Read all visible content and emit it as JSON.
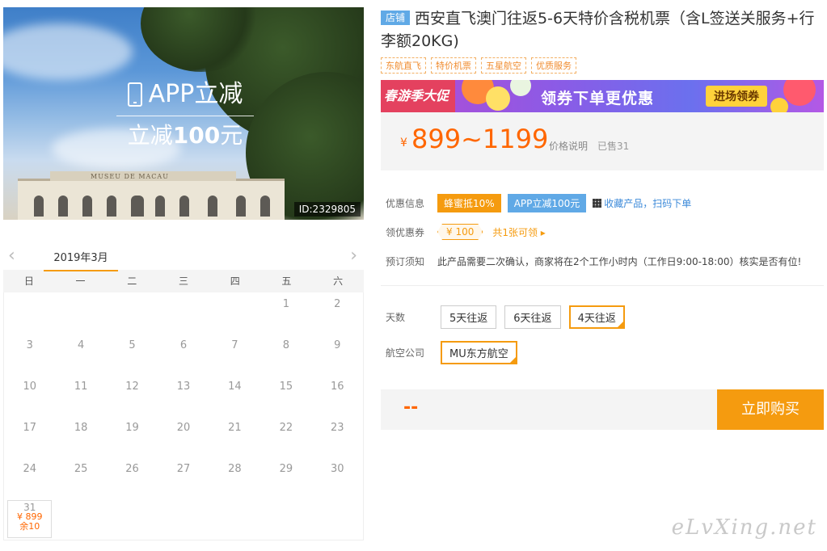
{
  "hero": {
    "app_label": "APP立减",
    "reduce_prefix": "立减",
    "reduce_amount": "100",
    "reduce_suffix": "元",
    "building_sign": "MUSEU DE MACAU",
    "id_tag": "ID:2329805"
  },
  "calendar": {
    "prev_icon": "chevron-left-icon",
    "next_icon": "chevron-right-icon",
    "month": "2019年3月",
    "weekdays": [
      "日",
      "一",
      "二",
      "三",
      "四",
      "五",
      "六"
    ],
    "weeks": [
      [
        "",
        "",
        "",
        "",
        "",
        "1",
        "2"
      ],
      [
        "3",
        "4",
        "5",
        "6",
        "7",
        "8",
        "9"
      ],
      [
        "10",
        "11",
        "12",
        "13",
        "14",
        "15",
        "16"
      ],
      [
        "17",
        "18",
        "19",
        "20",
        "21",
        "22",
        "23"
      ],
      [
        "24",
        "25",
        "26",
        "27",
        "28",
        "29",
        "30"
      ]
    ],
    "active_day": {
      "day": "31",
      "price": "¥ 899",
      "remain": "余10"
    }
  },
  "product": {
    "shop_badge": "店铺",
    "title": "西安直飞澳门往返5-6天特价含税机票（含L签送关服务+行李额20KG)",
    "tags": [
      "东航直飞",
      "特价机票",
      "五星航空",
      "优质服务"
    ]
  },
  "banner": {
    "left_text": "春游季大促",
    "mid_text": "领券下单更优惠",
    "button": "进场领券"
  },
  "price": {
    "currency": "¥",
    "range": "899~1199",
    "explain": "价格说明",
    "sold": "已售31"
  },
  "info": {
    "discount_label": "优惠信息",
    "discount_pill1": "蜂蜜抵10%",
    "discount_pill2": "APP立减100元",
    "collect_link": "收藏产品，扫码下单",
    "coupon_label": "领优惠券",
    "coupon_value": "¥ 100",
    "coupon_link": "共1张可领 ▸",
    "notice_label": "预订须知",
    "notice_text": "此产品需要二次确认，商家将在2个工作小时内（工作日9:00-18:00）核实是否有位!"
  },
  "options": {
    "days_label": "天数",
    "days": [
      "5天往返",
      "6天往返",
      "4天往返"
    ],
    "days_selected": "4天往返",
    "airline_label": "航空公司",
    "airlines": [
      "MU东方航空"
    ],
    "airline_selected": "MU东方航空"
  },
  "buy": {
    "price_placeholder": "--",
    "button": "立即购买"
  },
  "watermark": "eLvXing.net",
  "colors": {
    "accent_orange": "#f59b0f",
    "price_orange": "#ff6600",
    "badge_blue": "#60a9e6"
  }
}
